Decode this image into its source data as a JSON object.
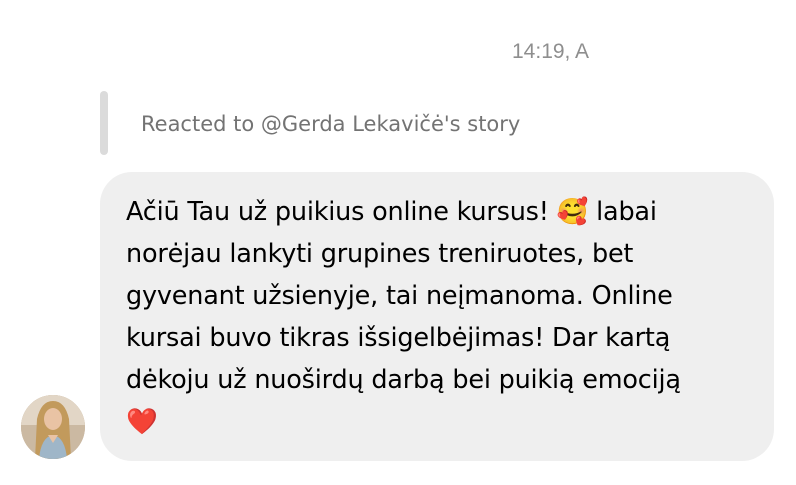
{
  "message": {
    "timestamp": "14:19, A",
    "reply_context": "Reacted to @Gerda Lekavičė's story",
    "text": "Ačiū Tau už puikius online kursus! 🥰 labai\nnorėjau lankyti grupines treniruotes, bet\ngyvenant užsienyje, tai neįmanoma. Online\nkursai buvo tikras išsigelbėjimas! Dar kartą\ndėkoju už nuoširdų darbą bei puikią emociją\n❤️"
  },
  "colors": {
    "bubble_background": "#efefef",
    "timestamp_text": "#8e8e8e",
    "reply_context_text": "#737373",
    "reply_bar": "#dbdbdb"
  },
  "icons": {
    "avatar": "user-photo"
  }
}
